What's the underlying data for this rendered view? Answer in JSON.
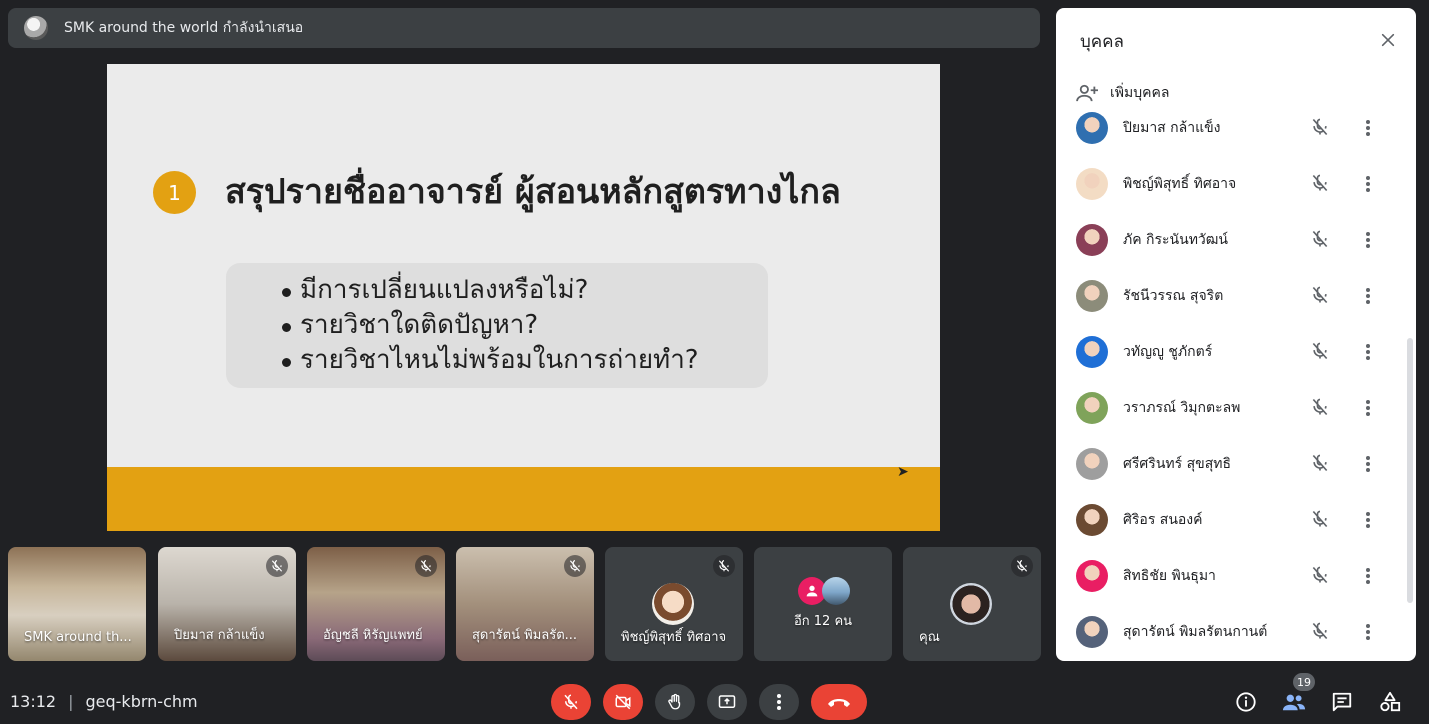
{
  "presenter": {
    "text": "SMK around the world กำลังนำเสนอ"
  },
  "slide": {
    "number": "1",
    "heading": "สรุปรายชื่ออาจารย์ ผู้สอนหลักสูตรทางไกล",
    "bullets": [
      "มีการเปลี่ยนแปลงหรือไม่?",
      "รายวิชาใดติดปัญหา?",
      "รายวิชาไหนไม่พร้อมในการถ่ายทำ?"
    ],
    "colors": {
      "accent": "#e3a112",
      "background": "#ebebeb",
      "box": "#dedede"
    }
  },
  "tiles": [
    {
      "name": "SMK around th..."
    },
    {
      "name": "ปิยมาส กล้าแข็ง"
    },
    {
      "name": "อัญชลี หิรัญแพทย์"
    },
    {
      "name": "สุดารัตน์ พิมลรัต..."
    },
    {
      "name": "พิชญ์พิสุทธิ์ ทิศอาจ"
    },
    {
      "name": "อีก 12 คน"
    },
    {
      "name": "คุณ"
    }
  ],
  "people_panel": {
    "title": "บุคคล",
    "add_label": "เพิ่มบุคคล",
    "people": [
      {
        "name": "ปิยมาส กล้าแข็ง",
        "avatar_color": "#2f6fb0"
      },
      {
        "name": "พิชญ์พิสุทธิ์ ทิศอาจ",
        "avatar_color": "#f3dcc4"
      },
      {
        "name": "ภัค กิระนันทวัฒน์",
        "avatar_color": "#8a3f57"
      },
      {
        "name": "รัชนีวรรณ สุจริต",
        "avatar_color": "#8c8c7a"
      },
      {
        "name": "วทัญญู ชูภักตร์",
        "avatar_color": "#1f6fd6"
      },
      {
        "name": "วราภรณ์ วิมุกตะลพ",
        "avatar_color": "#7fa35a"
      },
      {
        "name": "ศรีศรินทร์ สุขสุทธิ",
        "avatar_color": "#9e9e9e"
      },
      {
        "name": "ศิริอร สนองค์",
        "avatar_color": "#6b4a32"
      },
      {
        "name": "สิทธิชัย พินธุมา",
        "avatar_color": "#e91e63"
      },
      {
        "name": "สุดารัตน์ พิมลรัตนกานต์",
        "avatar_color": "#55627a"
      }
    ]
  },
  "bottom": {
    "time": "13:12",
    "meeting_code": "geq-kbrn-chm",
    "people_count": "19"
  },
  "colors": {
    "danger": "#ea4335",
    "surface": "#3c4043",
    "bg": "#202124",
    "people_blue": "#8ab4f8"
  }
}
